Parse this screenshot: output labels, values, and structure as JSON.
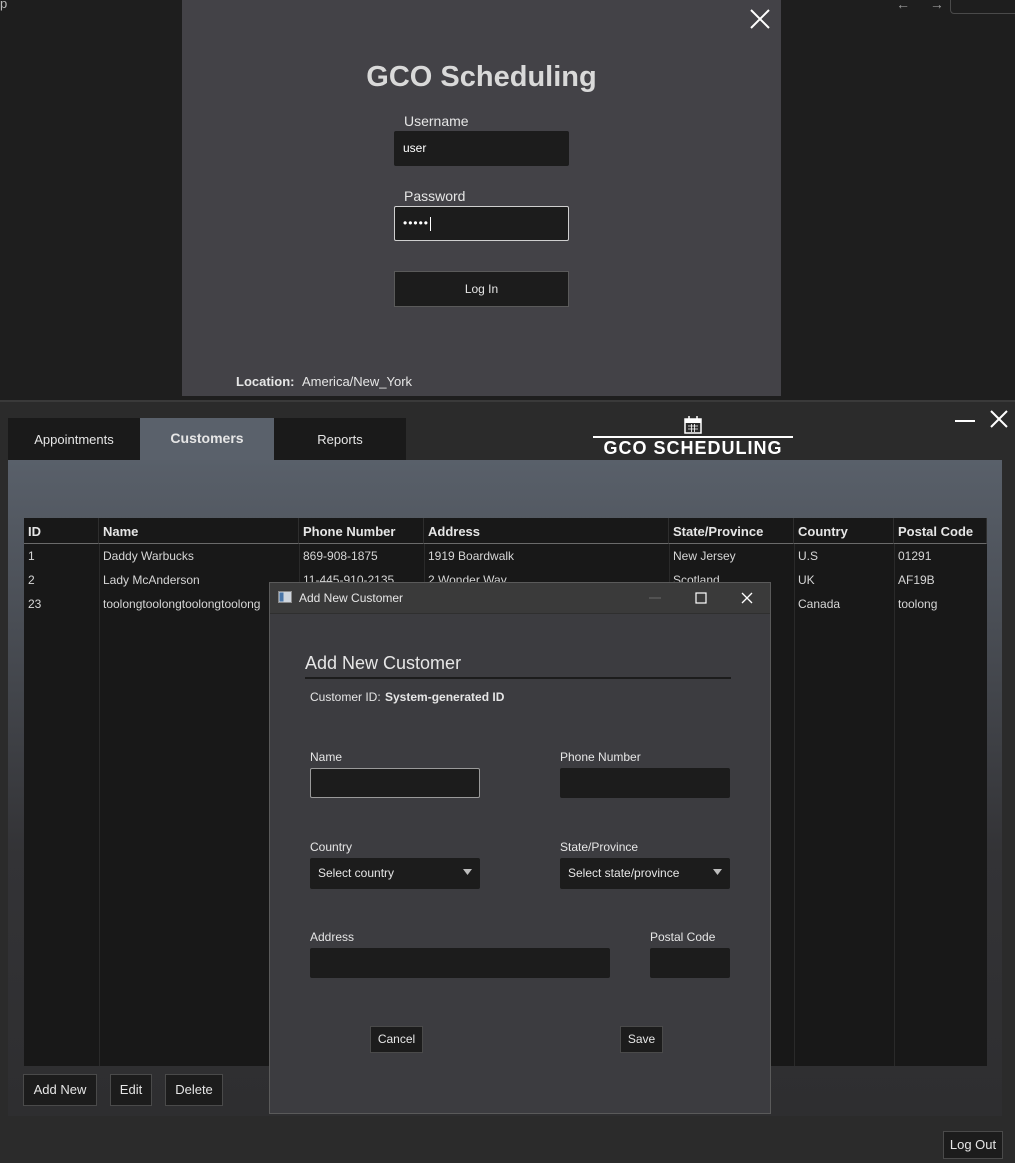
{
  "background": {
    "strip_text": "p",
    "nav_arrows": "← →"
  },
  "login": {
    "title": "GCO Scheduling",
    "username_label": "Username",
    "username_value": "user",
    "password_label": "Password",
    "password_masked": "•••••",
    "login_button": "Log In",
    "location_label": "Location:",
    "location_value": "America/New_York"
  },
  "main": {
    "tabs": [
      {
        "label": "Appointments",
        "active": false
      },
      {
        "label": "Customers",
        "active": true
      },
      {
        "label": "Reports",
        "active": false
      }
    ],
    "logo_text": "GCO SCHEDULING",
    "table": {
      "columns": [
        "ID",
        "Name",
        "Phone Number",
        "Address",
        "State/Province",
        "Country",
        "Postal Code"
      ],
      "rows": [
        [
          "1",
          "Daddy Warbucks",
          "869-908-1875",
          "1919 Boardwalk",
          "New Jersey",
          "U.S",
          "01291"
        ],
        [
          "2",
          "Lady McAnderson",
          "11-445-910-2135",
          "2 Wonder Way",
          "Scotland",
          "UK",
          "AF19B"
        ],
        [
          "23",
          "toolongtoolongtoolongtoolong",
          "",
          "",
          "",
          "Canada",
          "toolong"
        ]
      ]
    },
    "buttons": {
      "add_new": "Add New",
      "edit": "Edit",
      "delete": "Delete",
      "log_out": "Log Out"
    }
  },
  "dialog": {
    "window_title": "Add New Customer",
    "heading": "Add New Customer",
    "customer_id_label": "Customer ID:",
    "customer_id_value": "System-generated ID",
    "name_label": "Name",
    "name_value": "",
    "phone_label": "Phone Number",
    "phone_value": "",
    "country_label": "Country",
    "country_selected": "Select country",
    "state_label": "State/Province",
    "state_selected": "Select state/province",
    "address_label": "Address",
    "address_value": "",
    "postal_label": "Postal Code",
    "postal_value": "",
    "cancel_button": "Cancel",
    "save_button": "Save"
  }
}
